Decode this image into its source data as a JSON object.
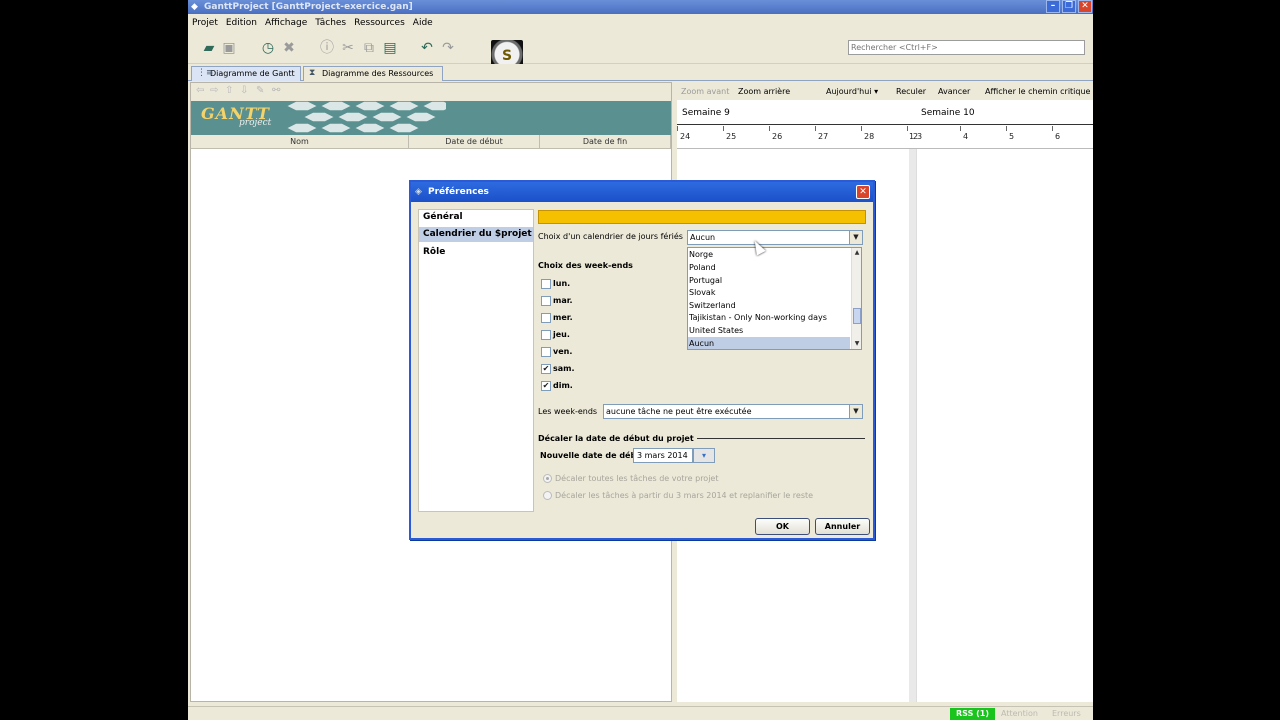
{
  "window": {
    "title": "GanttProject [GanttProject-exercice.gan]"
  },
  "menu": [
    "Projet",
    "Edition",
    "Affichage",
    "Tâches",
    "Ressources",
    "Aide"
  ],
  "toolbar": {
    "search_placeholder": "Rechercher <Ctrl+F>"
  },
  "tabs": [
    {
      "label": "Diagramme de Gantt"
    },
    {
      "label": "Diagramme des Ressources"
    }
  ],
  "left_panel": {
    "logo_text": "GANTT",
    "logo_sub": "project",
    "columns": [
      "Nom",
      "Date de début",
      "Date de fin"
    ]
  },
  "chart_toolbar": {
    "zoom_in": "Zoom avant",
    "zoom_out": "Zoom arrière",
    "today": "Aujourd'hui",
    "back": "Reculer",
    "forward": "Avancer",
    "critical_path": "Afficher le chemin critique"
  },
  "timeline": {
    "weeks": [
      "Semaine 9",
      "Semaine 10"
    ],
    "days": [
      "24",
      "25",
      "26",
      "27",
      "28",
      "1",
      "2",
      "3",
      "4",
      "5",
      "6"
    ]
  },
  "status": {
    "rss": "RSS (1)",
    "attention": "Attention",
    "errors": "Erreurs"
  },
  "dialog": {
    "title": "Préférences",
    "nav": [
      "Général",
      "Calendrier du $projet",
      "Rôle"
    ],
    "selected_nav": "Calendrier du $projet",
    "holiday_label": "Choix d'un calendrier de jours fériés",
    "holiday_value": "Aucun",
    "holiday_options": [
      "Norge",
      "Poland",
      "Portugal",
      "Slovak",
      "Switzerland",
      "Tajikistan - Only Non-working days",
      "United States",
      "Aucun"
    ],
    "weekend_heading": "Choix des week-ends",
    "weekdays": [
      {
        "label": "lun.",
        "checked": false
      },
      {
        "label": "mar.",
        "checked": false
      },
      {
        "label": "mer.",
        "checked": false
      },
      {
        "label": "jeu.",
        "checked": false
      },
      {
        "label": "ven.",
        "checked": false
      },
      {
        "label": "sam.",
        "checked": true
      },
      {
        "label": "dim.",
        "checked": true
      }
    ],
    "weekends_label": "Les week-ends",
    "weekends_value": "aucune tâche ne peut être exécutée",
    "shift_group_title": "Décaler la date de début du projet",
    "new_start_label": "Nouvelle date de début",
    "new_start_value": "3 mars 2014",
    "radio_all": "Décaler toutes les tâches de votre projet",
    "radio_from": "Décaler les tâches à partir du 3 mars 2014 et replanifier le reste",
    "ok": "OK",
    "cancel": "Annuler"
  },
  "colors": {
    "titlebar": "#4a6fc0",
    "dialog_border": "#2b5ad6",
    "banner": "#f5c000",
    "rss": "#19c41c",
    "selection": "#bfcde5"
  }
}
